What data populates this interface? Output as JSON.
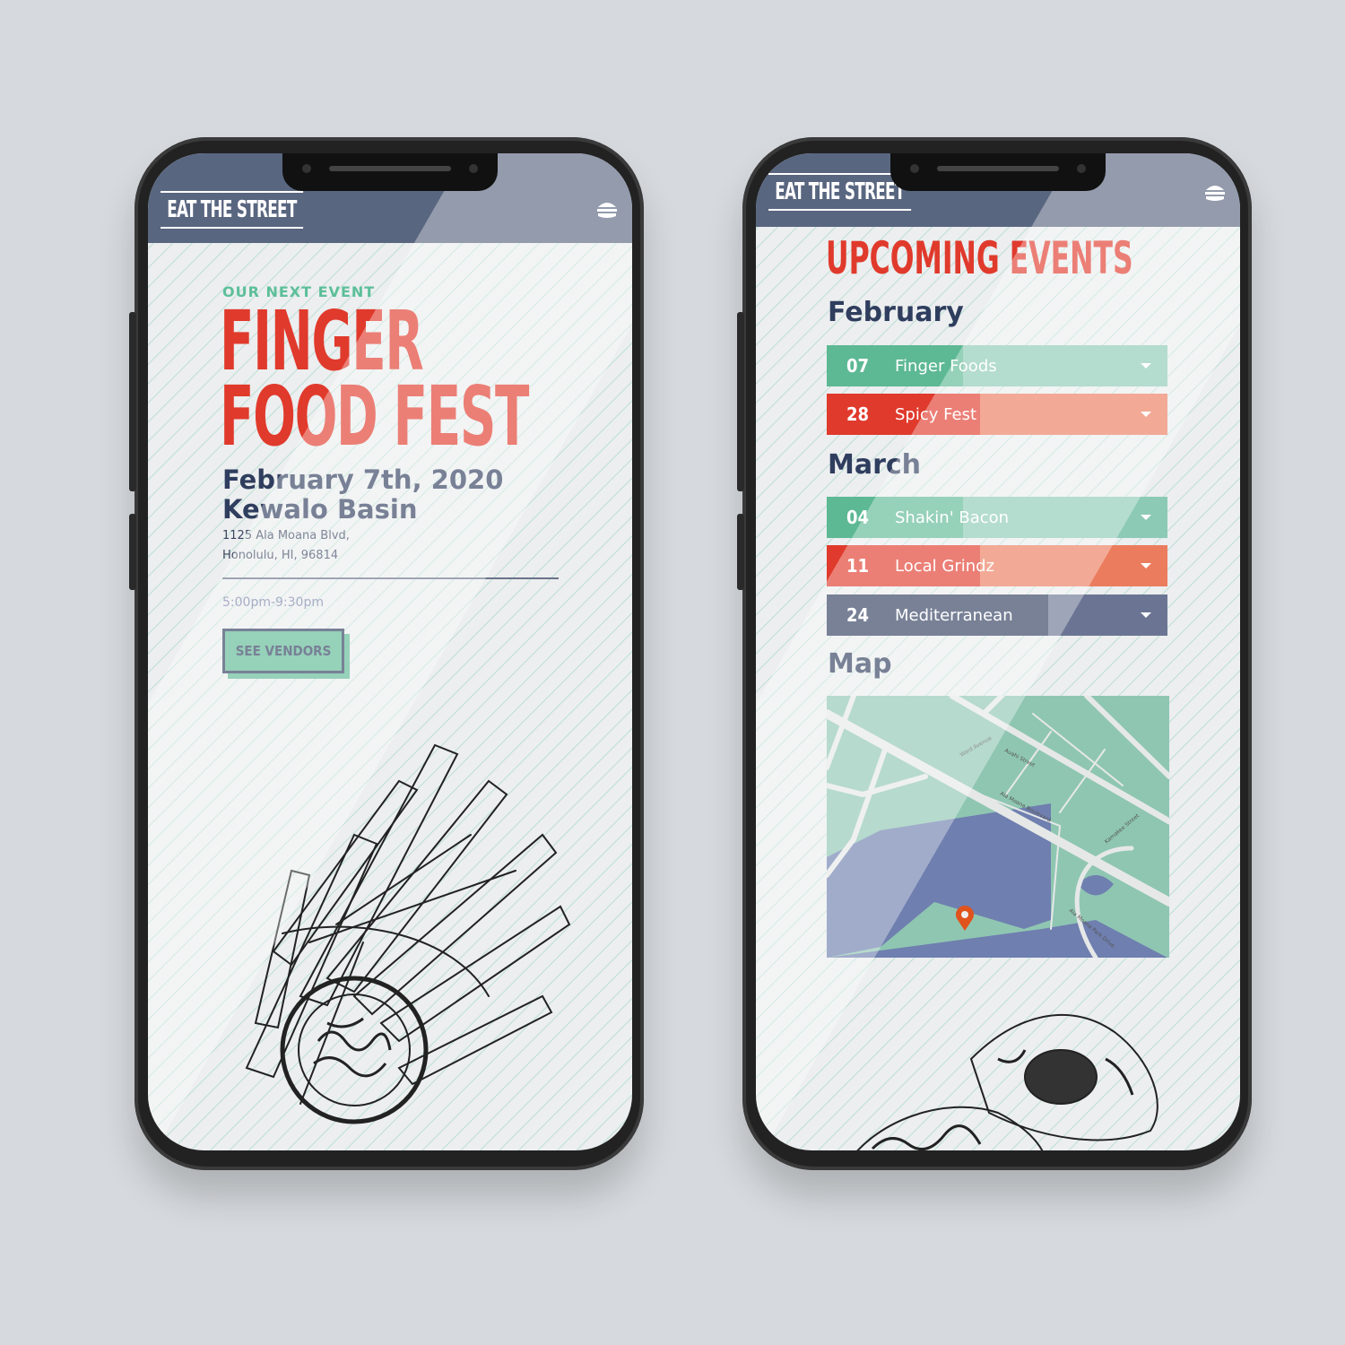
{
  "brand": {
    "logo_text": "EAT THE STREET",
    "menu_icon": "burger-icon"
  },
  "colors": {
    "navy": "#2f3d5e",
    "header": "#596680",
    "red": "#e03a2c",
    "coral": "#eb7d5e",
    "green": "#5db894",
    "background": "#d6dade"
  },
  "event_screen": {
    "eyebrow": "OUR NEXT EVENT",
    "title_line1": "FINGER",
    "title_line2": "FOOD FEST",
    "date": "February 7th, 2020",
    "venue": "Kewalo Basin",
    "address_line1": "1125 Ala Moana Blvd,",
    "address_line2": "Honolulu, HI, 96814",
    "time": "5:00pm-9:30pm",
    "cta": "SEE VENDORS"
  },
  "upcoming_screen": {
    "title": "UPCOMING EVENTS",
    "months": [
      {
        "name": "February",
        "events": [
          {
            "day": "07",
            "name": "Finger Foods",
            "color": "green"
          },
          {
            "day": "28",
            "name": "Spicy Fest",
            "color": "red"
          }
        ]
      },
      {
        "name": "March",
        "events": [
          {
            "day": "04",
            "name": "Shakin' Bacon",
            "color": "green"
          },
          {
            "day": "11",
            "name": "Local Grindz",
            "color": "red"
          },
          {
            "day": "24",
            "name": "Mediterranean",
            "color": "navy"
          }
        ]
      }
    ],
    "map_heading": "Map",
    "map_labels": [
      "Ward Avenue",
      "Auahi Street",
      "Ala Moana Boulevard",
      "Kamakee Street",
      "Ala Moana Park Drive"
    ]
  }
}
